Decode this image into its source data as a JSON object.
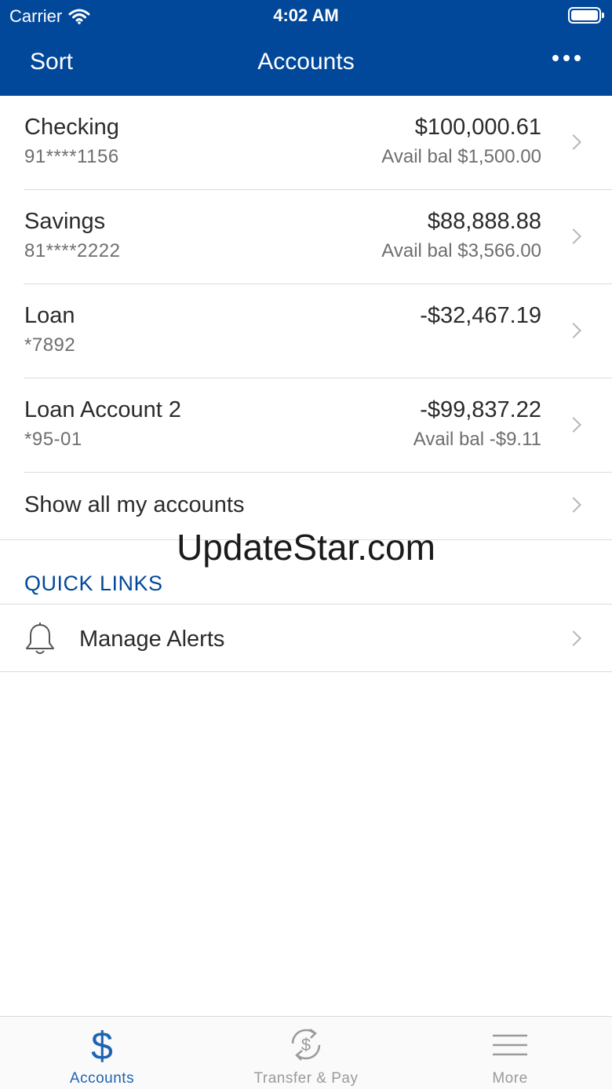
{
  "status_bar": {
    "carrier": "Carrier",
    "time": "4:02 AM"
  },
  "navbar": {
    "left_button": "Sort",
    "title": "Accounts"
  },
  "accounts": [
    {
      "name": "Checking",
      "number": "91****1156",
      "balance": "$100,000.61",
      "avail": "Avail bal $1,500.00"
    },
    {
      "name": "Savings",
      "number": "81****2222",
      "balance": "$88,888.88",
      "avail": "Avail bal $3,566.00"
    },
    {
      "name": "Loan",
      "number": "*7892",
      "balance": "-$32,467.19",
      "avail": ""
    },
    {
      "name": "Loan Account 2",
      "number": "*95-01",
      "balance": "-$99,837.22",
      "avail": "Avail bal -$9.11"
    }
  ],
  "show_all": "Show all my accounts",
  "watermark": "UpdateStar.com",
  "quick_links": {
    "header": "QUICK LINKS",
    "items": [
      {
        "label": "Manage Alerts",
        "icon": "bell-icon"
      }
    ]
  },
  "tabbar": {
    "tabs": [
      {
        "label": "Accounts",
        "icon": "dollar-icon",
        "active": true
      },
      {
        "label": "Transfer & Pay",
        "icon": "transfer-dollar-icon",
        "active": false
      },
      {
        "label": "More",
        "icon": "hamburger-icon",
        "active": false
      }
    ]
  },
  "colors": {
    "brand_blue": "#02489a",
    "active_tab": "#1f63b3",
    "inactive_tab": "#9a9a9a"
  }
}
